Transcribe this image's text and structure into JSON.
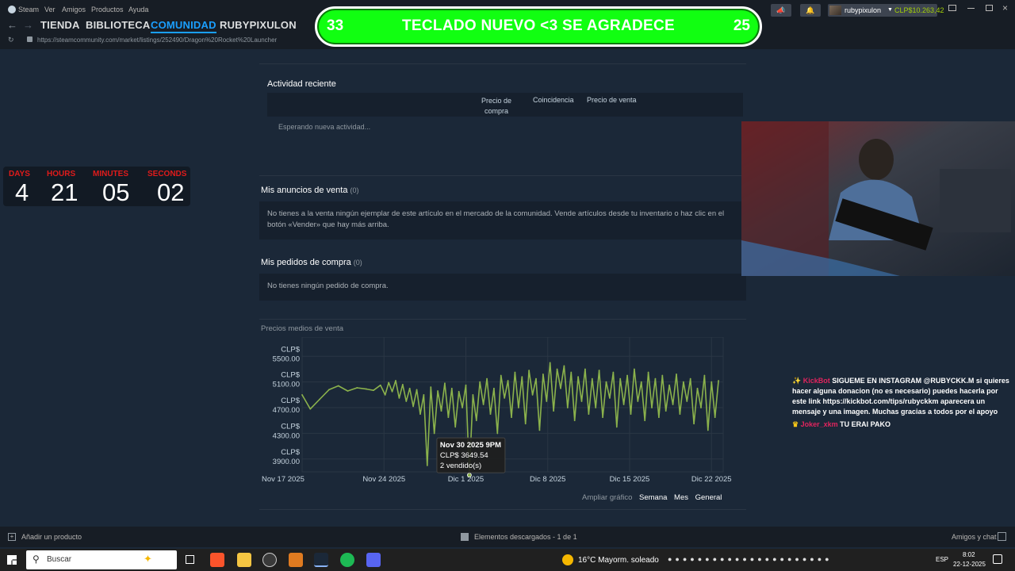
{
  "menu": [
    "Steam",
    "Ver",
    "Amigos",
    "Productos",
    "Ayuda"
  ],
  "nav_tabs": [
    "TIENDA",
    "BIBLIOTECA",
    "COMUNIDAD",
    "RUBYPIXULON"
  ],
  "url": "https://steamcommunity.com/market/listings/252490/Dragon%20Rocket%20Launcher",
  "banner": {
    "left_num": "33",
    "text": "TECLADO NUEVO <3 SE AGRADECE",
    "right_num": "25"
  },
  "account": {
    "name": "rubypixulon",
    "balance": "CLP$10.263,42"
  },
  "timer": {
    "labels": [
      "DAYS",
      "HOURS",
      "MINUTES",
      "SECONDS"
    ],
    "values": [
      "4",
      "21",
      "05",
      "02"
    ]
  },
  "recent": {
    "title": "Actividad reciente",
    "col_buy": "Precio de compra",
    "col_match": "Coincidencia",
    "col_sell": "Precio de venta",
    "waiting": "Esperando nueva actividad..."
  },
  "listings": {
    "title": "Mis anuncios de venta",
    "count": "(0)",
    "body": "No tienes a la venta ningún ejemplar de este artículo en el mercado de la comunidad. Vende artículos desde tu inventario o haz clic en el botón «Vender» que hay más arriba."
  },
  "orders": {
    "title": "Mis pedidos de compra",
    "count": "(0)",
    "body": "No tienes ningún pedido de compra."
  },
  "chart_title": "Precios medios de venta",
  "chart_data": {
    "type": "line",
    "title": "Precios medios de venta",
    "xlabel": "",
    "ylabel": "",
    "y_tick_labels": [
      {
        "currency": "CLP$",
        "value": "5500.00"
      },
      {
        "currency": "CLP$",
        "value": "5100.00"
      },
      {
        "currency": "CLP$",
        "value": "4700.00"
      },
      {
        "currency": "CLP$",
        "value": "4300.00"
      },
      {
        "currency": "CLP$",
        "value": "3900.00"
      }
    ],
    "y_ticks": [
      5500,
      5100,
      4700,
      4300,
      3900
    ],
    "ylim": [
      3700,
      5800
    ],
    "x_tick_labels": [
      "Nov 17 2025",
      "Nov 24 2025",
      "Dic 1 2025",
      "Dic 8 2025",
      "Dic 15 2025",
      "Dic 22 2025"
    ],
    "x_tick_days": [
      0,
      7,
      14,
      21,
      28,
      35
    ],
    "xlim_days": [
      0,
      36
    ],
    "color": "#8bb24c",
    "series": [
      {
        "points": [
          [
            0.0,
            4900
          ],
          [
            0.7,
            4680
          ],
          [
            1.5,
            4830
          ],
          [
            2.3,
            4980
          ],
          [
            3.1,
            5040
          ],
          [
            3.9,
            4960
          ],
          [
            4.7,
            5010
          ],
          [
            5.5,
            4990
          ],
          [
            6.1,
            4970
          ],
          [
            6.7,
            5050
          ],
          [
            7.1,
            4900
          ],
          [
            7.4,
            5090
          ],
          [
            7.7,
            4950
          ],
          [
            8.0,
            5120
          ],
          [
            8.3,
            4850
          ],
          [
            8.6,
            5060
          ],
          [
            8.9,
            4800
          ],
          [
            9.2,
            5000
          ],
          [
            9.5,
            4720
          ],
          [
            9.8,
            4980
          ],
          [
            10.1,
            4600
          ],
          [
            10.4,
            4900
          ],
          [
            10.7,
            3800
          ],
          [
            11.0,
            5020
          ],
          [
            11.3,
            4300
          ],
          [
            11.6,
            4960
          ],
          [
            11.9,
            4650
          ],
          [
            12.2,
            5080
          ],
          [
            12.5,
            4550
          ],
          [
            12.8,
            5000
          ],
          [
            13.1,
            4400
          ],
          [
            13.4,
            4950
          ],
          [
            13.7,
            4700
          ],
          [
            14.0,
            5050
          ],
          [
            14.3,
            3649.54
          ],
          [
            14.6,
            4900
          ],
          [
            14.9,
            4500
          ],
          [
            15.2,
            5100
          ],
          [
            15.5,
            4750
          ],
          [
            15.8,
            5150
          ],
          [
            16.1,
            4600
          ],
          [
            16.4,
            5000
          ],
          [
            16.7,
            4300
          ],
          [
            17.0,
            5200
          ],
          [
            17.3,
            4850
          ],
          [
            17.6,
            5120
          ],
          [
            17.9,
            4550
          ],
          [
            18.2,
            5250
          ],
          [
            18.5,
            4700
          ],
          [
            18.8,
            5180
          ],
          [
            19.1,
            4450
          ],
          [
            19.4,
            5280
          ],
          [
            19.7,
            4900
          ],
          [
            20.0,
            5150
          ],
          [
            20.3,
            4350
          ],
          [
            20.6,
            5220
          ],
          [
            20.9,
            4800
          ],
          [
            21.2,
            5400
          ],
          [
            21.5,
            4650
          ],
          [
            21.8,
            5300
          ],
          [
            22.1,
            5000
          ],
          [
            22.4,
            5350
          ],
          [
            22.7,
            4700
          ],
          [
            23.0,
            5250
          ],
          [
            23.3,
            4500
          ],
          [
            23.6,
            5180
          ],
          [
            23.9,
            4800
          ],
          [
            24.2,
            5300
          ],
          [
            24.5,
            4600
          ],
          [
            24.8,
            5150
          ],
          [
            25.1,
            4700
          ],
          [
            25.4,
            5280
          ],
          [
            25.7,
            4550
          ],
          [
            26.0,
            5100
          ],
          [
            26.3,
            4850
          ],
          [
            26.6,
            5250
          ],
          [
            26.9,
            4400
          ],
          [
            27.2,
            5150
          ],
          [
            27.5,
            4750
          ],
          [
            27.8,
            5200
          ],
          [
            28.1,
            4600
          ],
          [
            28.4,
            5300
          ],
          [
            28.7,
            4800
          ],
          [
            29.0,
            5100
          ],
          [
            29.3,
            4500
          ],
          [
            29.6,
            5250
          ],
          [
            29.9,
            4700
          ],
          [
            30.2,
            5150
          ],
          [
            30.5,
            4550
          ],
          [
            30.8,
            5200
          ],
          [
            31.1,
            4650
          ],
          [
            31.4,
            5050
          ],
          [
            31.7,
            4750
          ],
          [
            32.0,
            5220
          ],
          [
            32.3,
            4600
          ],
          [
            32.6,
            5100
          ],
          [
            32.9,
            4800
          ],
          [
            33.2,
            5150
          ],
          [
            33.5,
            4450
          ],
          [
            33.8,
            5000
          ],
          [
            34.1,
            4700
          ],
          [
            34.4,
            5200
          ],
          [
            34.7,
            4350
          ],
          [
            35.0,
            5100
          ],
          [
            35.3,
            4550
          ],
          [
            35.6,
            5120
          ]
        ]
      }
    ],
    "tooltip": {
      "date": "Nov 30 2025 9PM",
      "price": "CLP$ 3649.54",
      "sold": "2 vendido(s)"
    }
  },
  "zoom": {
    "label": "Ampliar gráfico",
    "options": [
      "Semana",
      "Mes",
      "General"
    ]
  },
  "chat": [
    {
      "user": "KickBot",
      "text": "SIGUEME EN INSTAGRAM @RUBYCKK.M si quieres hacer alguna donacion (no es necesario) puedes hacerla por este link https://kickbot.com/tips/rubyckkm aparecera un mensaje y una imagen. Muchas gracias a todos por el apoyo",
      "color": "#e0245e"
    },
    {
      "user": "Joker_xkm",
      "text": "TU ERAI PAKO",
      "color": "#e0245e"
    }
  ],
  "status_bar": {
    "add": "Añadir un producto",
    "downloads": "Elementos descargados - 1 de 1",
    "friends": "Amigos y chat"
  },
  "taskbar": {
    "search": "Buscar",
    "weather": "16°C  Mayorm. soleado",
    "lang": "ESP",
    "time": "8:02",
    "date": "22-12-2025"
  }
}
